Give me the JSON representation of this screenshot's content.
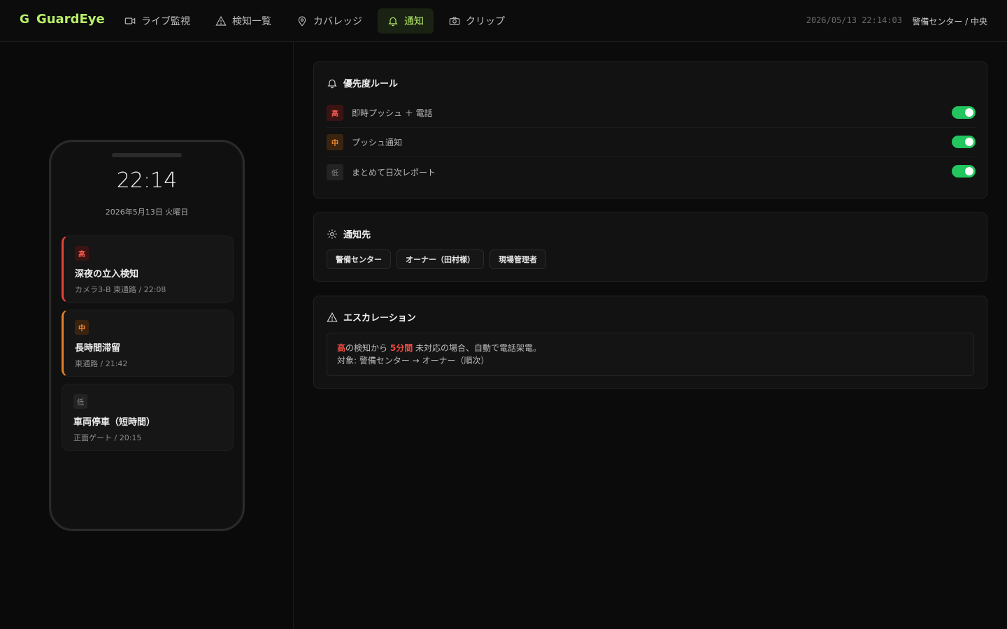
{
  "app": {
    "brand_mark": "G",
    "brand_name": "GuardEye"
  },
  "nav": [
    {
      "label": "ライブ監視",
      "icon": "video-camera-icon",
      "active": false
    },
    {
      "label": "検知一覧",
      "icon": "warning-triangle-icon",
      "active": false
    },
    {
      "label": "カバレッジ",
      "icon": "map-pin-icon",
      "active": false
    },
    {
      "label": "通知",
      "icon": "bell-icon",
      "active": true
    },
    {
      "label": "クリップ",
      "icon": "camera-icon",
      "active": false
    }
  ],
  "header": {
    "datetime": "2026/05/13 22:14:03",
    "location": "警備センター / 中央"
  },
  "phone": {
    "time": "22:14",
    "date": "2026年5月13日 火曜日",
    "notifications": [
      {
        "level": "高",
        "title": "深夜の立入検知",
        "subtitle": "カメラ3-B 東通路 / 22:08"
      },
      {
        "level": "中",
        "title": "長時間滞留",
        "subtitle": "東通路 / 21:42"
      },
      {
        "level": "低",
        "title": "車両停車（短時間）",
        "subtitle": "正面ゲート / 20:15"
      }
    ]
  },
  "priority_rules": {
    "title": "優先度ルール",
    "rules": [
      {
        "level": "高",
        "label": "即時プッシュ ＋ 電話",
        "enabled": true
      },
      {
        "level": "中",
        "label": "プッシュ通知",
        "enabled": true
      },
      {
        "level": "低",
        "label": "まとめて日次レポート",
        "enabled": true
      }
    ]
  },
  "recipients": {
    "title": "通知先",
    "chips": [
      "警備センター",
      "オーナー（田村様）",
      "現場管理者"
    ]
  },
  "escalation": {
    "title": "エスカレーション",
    "line1_level": "高",
    "line1_mid": "の検知から ",
    "line1_duration": "5分間",
    "line1_end": " 未対応の場合、自動で電話架電。",
    "line2": "対象: 警備センター → オーナー（順次）"
  },
  "colors": {
    "accent": "#b8f06a",
    "high": "#ef5a50",
    "mid": "#f08a33",
    "toggle_on": "#22c55e"
  }
}
